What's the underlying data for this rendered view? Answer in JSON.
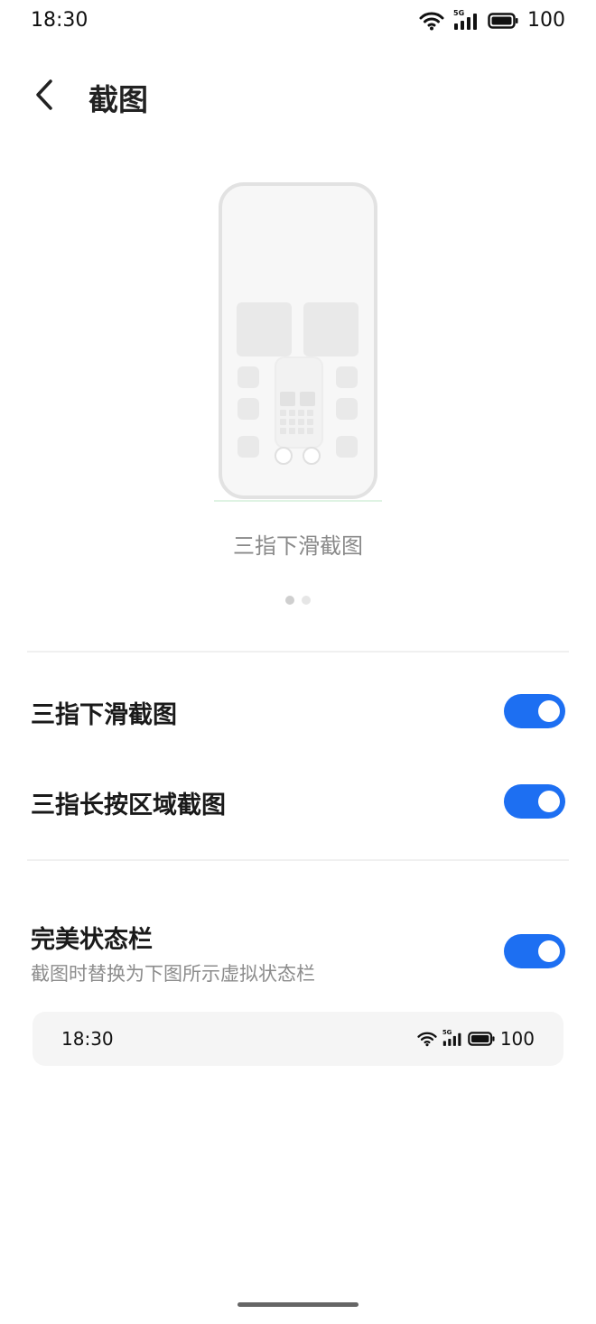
{
  "status_bar": {
    "time": "18:30",
    "network_label": "5G",
    "battery_level": "100",
    "icons": [
      "wifi-icon",
      "signal-icon",
      "battery-icon"
    ]
  },
  "header": {
    "back_icon": "chevron-left-icon",
    "title": "截图"
  },
  "illustration": {
    "caption": "三指下滑截图",
    "pager": {
      "total": 2,
      "active_index": 0
    }
  },
  "settings": {
    "three_finger_swipe": {
      "label": "三指下滑截图",
      "enabled": true
    },
    "three_finger_hold": {
      "label": "三指长按区域截图",
      "enabled": true
    },
    "perfect_status_bar": {
      "label": "完美状态栏",
      "description": "截图时替换为下图所示虚拟状态栏",
      "enabled": true
    }
  },
  "preview_status_bar": {
    "time": "18:30",
    "network_label": "5G",
    "battery_level": "100"
  },
  "colors": {
    "accent": "#1d6ff2",
    "toggle_knob": "#ffffff",
    "pager_active": "#cfcfcf",
    "pager_inactive": "#e6e6e6",
    "secondary_text": "#8c8c8c",
    "caption_text": "#8a8a8a"
  }
}
